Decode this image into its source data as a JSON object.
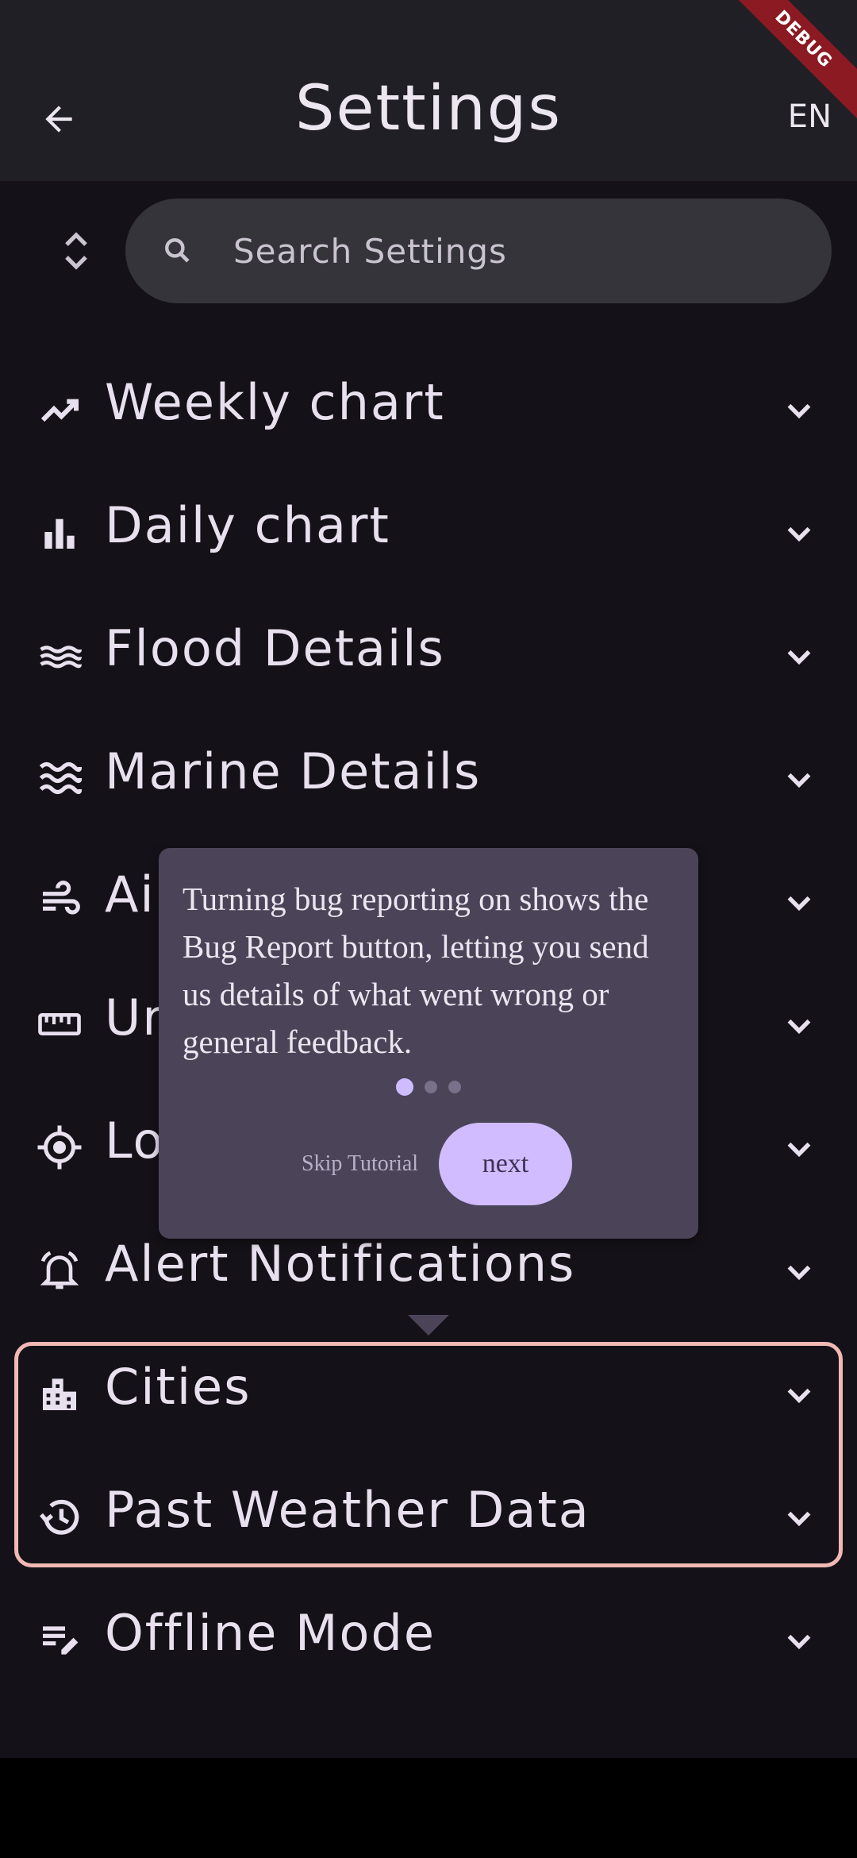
{
  "appbar": {
    "title": "Settings",
    "lang": "EN",
    "debug": "DEBUG"
  },
  "search": {
    "placeholder": "Search Settings"
  },
  "items": [
    {
      "label": "Weekly chart",
      "icon": "trending-up-icon"
    },
    {
      "label": "Daily chart",
      "icon": "bar-chart-icon"
    },
    {
      "label": "Flood Details",
      "icon": "flood-waves-icon"
    },
    {
      "label": "Marine Details",
      "icon": "marine-waves-icon"
    },
    {
      "label": "Ai",
      "icon": "air-wind-icon"
    },
    {
      "label": "Ur",
      "icon": "ruler-icon"
    },
    {
      "label": "Lo",
      "icon": "location-target-icon"
    },
    {
      "label": "Alert Notifications",
      "icon": "alarm-bell-icon"
    },
    {
      "label": "Cities",
      "icon": "city-buildings-icon"
    },
    {
      "label": "Past Weather Data",
      "icon": "history-clock-icon"
    },
    {
      "label": "Offline Mode",
      "icon": "edit-list-icon"
    }
  ],
  "tutorial": {
    "text": "Turning bug reporting on shows the Bug Report button, letting you send us details of what went wrong or general feedback.",
    "skip_label": "Skip Tutorial",
    "next_label": "next",
    "step": 1,
    "total_steps": 3
  },
  "colors": {
    "background": "#141218",
    "appbar": "#211f26",
    "tooltip": "#4b4459",
    "accent": "#d0bcff",
    "highlight": "#f2b8b5"
  }
}
